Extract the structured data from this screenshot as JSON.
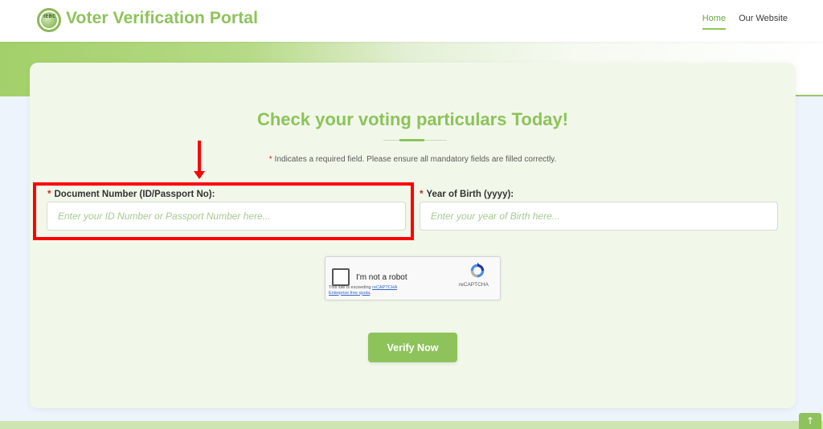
{
  "header": {
    "logo_text": "IEBC",
    "brand": "Voter Verification Portal",
    "nav": [
      {
        "label": "Home",
        "active": true
      },
      {
        "label": "Our Website",
        "active": false
      }
    ]
  },
  "form": {
    "title": "Check your voting particulars Today!",
    "required_note": "Indicates a required field. Please ensure all mandatory fields are filled correctly.",
    "required_marker": "*",
    "document_number": {
      "label": "Document Number (ID/Passport No):",
      "value": "",
      "placeholder": "Enter your ID Number or Passport Number here..."
    },
    "year_of_birth": {
      "label": "Year of Birth (yyyy):",
      "value": "",
      "placeholder": "Enter your year of Birth here..."
    },
    "captcha": {
      "label": "I'm not a robot",
      "brand": "reCAPTCHA",
      "note_prefix": "This site is exceeding",
      "note_link1": "reCAPTCHA",
      "note_link2": "Enterprise free quota",
      "note_suffix": "."
    },
    "submit_label": "Verify Now"
  },
  "scroll_top_icon": "arrow-up-icon",
  "colors": {
    "accent": "#8dc35a",
    "required": "#e11b1b",
    "annotation": "#ff0000",
    "card_bg": "#f1f8ea"
  }
}
